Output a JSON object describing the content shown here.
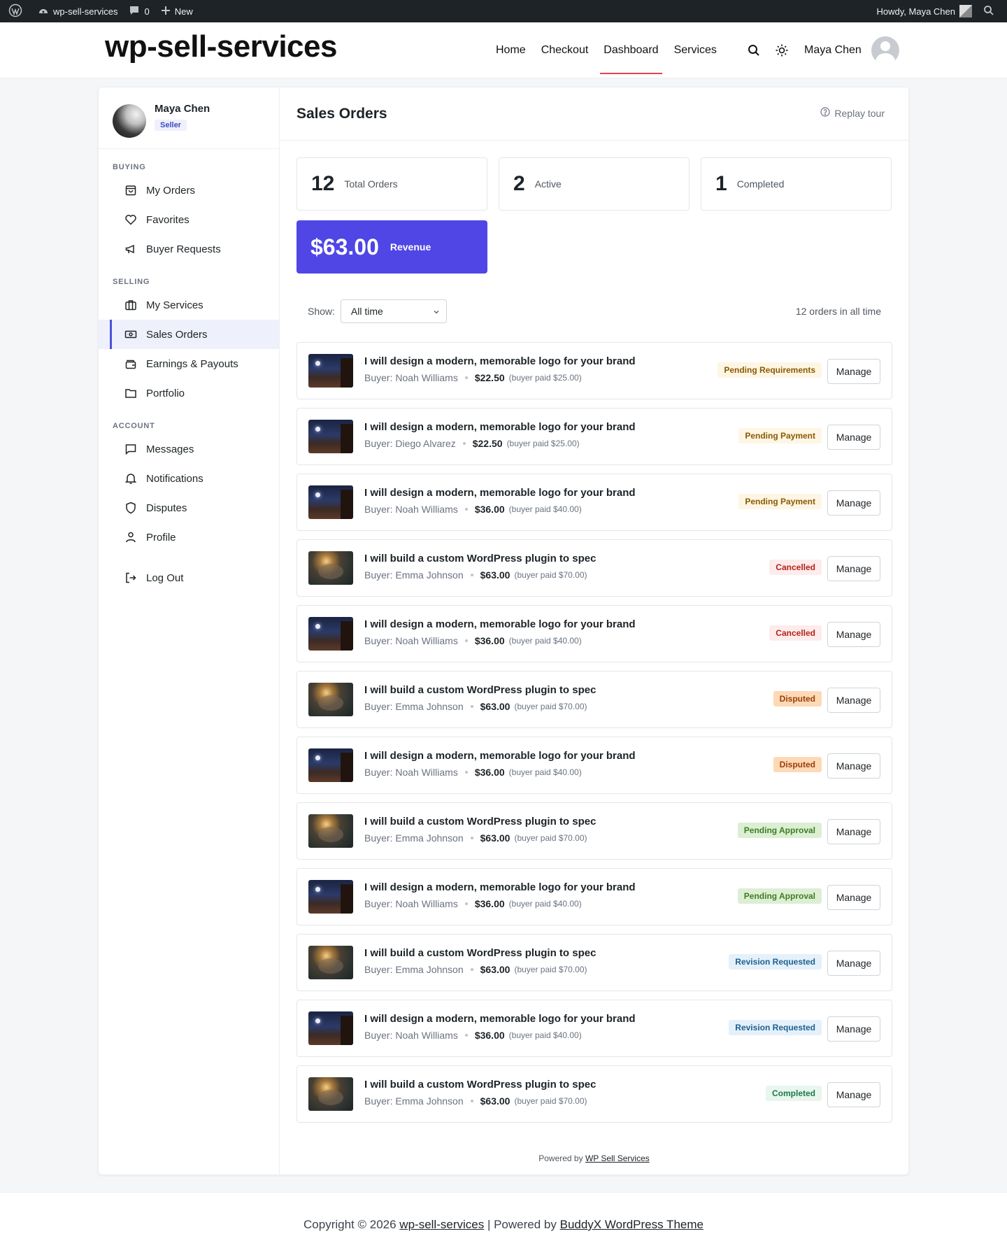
{
  "adminbar": {
    "site_name": "wp-sell-services",
    "comments_count": "0",
    "new_label": "New",
    "howdy": "Howdy, Maya Chen"
  },
  "header": {
    "site_title": "wp-sell-services",
    "nav": [
      {
        "label": "Home",
        "active": false
      },
      {
        "label": "Checkout",
        "active": false
      },
      {
        "label": "Dashboard",
        "active": true
      },
      {
        "label": "Services",
        "active": false
      }
    ],
    "user_name": "Maya Chen"
  },
  "sidebar": {
    "profile_name": "Maya Chen",
    "role_badge": "Seller",
    "sections": [
      {
        "title": "BUYING",
        "items": [
          {
            "label": "My Orders",
            "icon": "bag-icon"
          },
          {
            "label": "Favorites",
            "icon": "heart-icon"
          },
          {
            "label": "Buyer Requests",
            "icon": "megaphone-icon"
          }
        ]
      },
      {
        "title": "SELLING",
        "items": [
          {
            "label": "My Services",
            "icon": "briefcase-icon"
          },
          {
            "label": "Sales Orders",
            "icon": "money-icon",
            "active": true
          },
          {
            "label": "Earnings & Payouts",
            "icon": "wallet-icon"
          },
          {
            "label": "Portfolio",
            "icon": "folder-icon"
          }
        ]
      },
      {
        "title": "ACCOUNT",
        "items": [
          {
            "label": "Messages",
            "icon": "message-icon"
          },
          {
            "label": "Notifications",
            "icon": "bell-icon"
          },
          {
            "label": "Disputes",
            "icon": "shield-icon"
          },
          {
            "label": "Profile",
            "icon": "user-icon"
          }
        ]
      }
    ],
    "logout_label": "Log Out"
  },
  "content": {
    "title": "Sales Orders",
    "replay_label": "Replay tour",
    "stats": [
      {
        "value": "12",
        "label": "Total Orders"
      },
      {
        "value": "2",
        "label": "Active"
      },
      {
        "value": "1",
        "label": "Completed"
      }
    ],
    "revenue": {
      "value": "$63.00",
      "label": "Revenue"
    },
    "filter": {
      "label": "Show:",
      "selected": "All time",
      "count_text": "12 orders in all time"
    },
    "orders": [
      {
        "title": "I will design a modern, memorable logo for your brand",
        "buyer": "Buyer: Noah Williams",
        "price": "$22.50",
        "paid": "(buyer paid $25.00)",
        "status": "Pending Requirements",
        "status_class": "st-pending-req",
        "thumb": "night"
      },
      {
        "title": "I will design a modern, memorable logo for your brand",
        "buyer": "Buyer: Diego Alvarez",
        "price": "$22.50",
        "paid": "(buyer paid $25.00)",
        "status": "Pending Payment",
        "status_class": "st-pending-pay",
        "thumb": "night"
      },
      {
        "title": "I will design a modern, memorable logo for your brand",
        "buyer": "Buyer: Noah Williams",
        "price": "$36.00",
        "paid": "(buyer paid $40.00)",
        "status": "Pending Payment",
        "status_class": "st-pending-pay",
        "thumb": "night"
      },
      {
        "title": "I will build a custom WordPress plugin to spec",
        "buyer": "Buyer: Emma Johnson",
        "price": "$63.00",
        "paid": "(buyer paid $70.00)",
        "status": "Cancelled",
        "status_class": "st-cancelled",
        "thumb": "hands"
      },
      {
        "title": "I will design a modern, memorable logo for your brand",
        "buyer": "Buyer: Noah Williams",
        "price": "$36.00",
        "paid": "(buyer paid $40.00)",
        "status": "Cancelled",
        "status_class": "st-cancelled",
        "thumb": "night"
      },
      {
        "title": "I will build a custom WordPress plugin to spec",
        "buyer": "Buyer: Emma Johnson",
        "price": "$63.00",
        "paid": "(buyer paid $70.00)",
        "status": "Disputed",
        "status_class": "st-disputed",
        "thumb": "hands"
      },
      {
        "title": "I will design a modern, memorable logo for your brand",
        "buyer": "Buyer: Noah Williams",
        "price": "$36.00",
        "paid": "(buyer paid $40.00)",
        "status": "Disputed",
        "status_class": "st-disputed",
        "thumb": "night"
      },
      {
        "title": "I will build a custom WordPress plugin to spec",
        "buyer": "Buyer: Emma Johnson",
        "price": "$63.00",
        "paid": "(buyer paid $70.00)",
        "status": "Pending Approval",
        "status_class": "st-approval",
        "thumb": "hands"
      },
      {
        "title": "I will design a modern, memorable logo for your brand",
        "buyer": "Buyer: Noah Williams",
        "price": "$36.00",
        "paid": "(buyer paid $40.00)",
        "status": "Pending Approval",
        "status_class": "st-approval",
        "thumb": "night"
      },
      {
        "title": "I will build a custom WordPress plugin to spec",
        "buyer": "Buyer: Emma Johnson",
        "price": "$63.00",
        "paid": "(buyer paid $70.00)",
        "status": "Revision Requested",
        "status_class": "st-revision",
        "thumb": "hands"
      },
      {
        "title": "I will design a modern, memorable logo for your brand",
        "buyer": "Buyer: Noah Williams",
        "price": "$36.00",
        "paid": "(buyer paid $40.00)",
        "status": "Revision Requested",
        "status_class": "st-revision",
        "thumb": "night"
      },
      {
        "title": "I will build a custom WordPress plugin to spec",
        "buyer": "Buyer: Emma Johnson",
        "price": "$63.00",
        "paid": "(buyer paid $70.00)",
        "status": "Completed",
        "status_class": "st-completed",
        "thumb": "hands"
      }
    ],
    "manage_label": "Manage",
    "powered_prefix": "Powered by",
    "powered_link": "WP Sell Services"
  },
  "footer": {
    "copyright_prefix": "Copyright © 2026",
    "site_link": "wp-sell-services",
    "powered_prefix": "| Powered by",
    "theme_link": "BuddyX WordPress Theme"
  },
  "colors": {
    "accent": "#4f46e5",
    "nav_underline": "#e0454f"
  }
}
